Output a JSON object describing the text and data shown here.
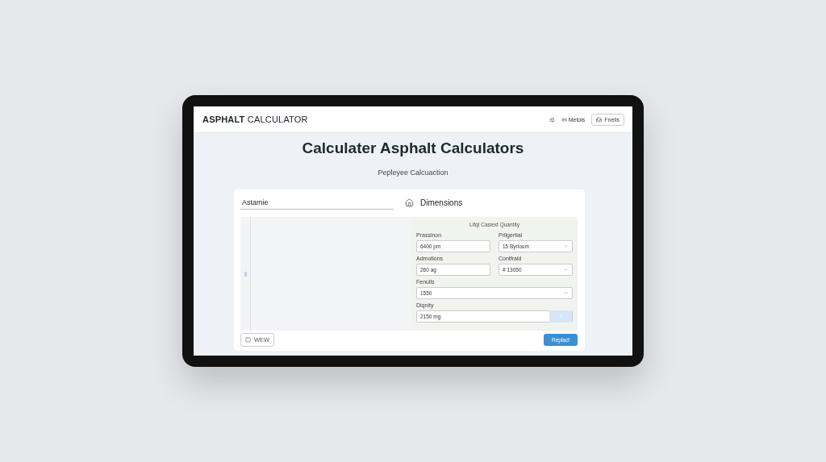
{
  "header": {
    "brand_bold": "ASPHALT",
    "brand_rest": "CALCULATOR",
    "link": "Metols",
    "button": "Fnells"
  },
  "hero": {
    "title": "Calculater Asphalt Calculators",
    "subtitle": "Pepleyee Calcuaction"
  },
  "card": {
    "name_field": {
      "value": "Astamie"
    },
    "section_title": "Dimensions",
    "form_title": "Lifqt Casiext Quantity",
    "fields": [
      {
        "label": "Prassinon",
        "value": "6400 pm",
        "kind": "text",
        "wide": false
      },
      {
        "label": "Prllgertial",
        "value": "15 Byrioum",
        "kind": "select",
        "wide": false
      },
      {
        "label": "Admotions",
        "value": "260 ag",
        "kind": "text",
        "wide": false
      },
      {
        "label": "Contfrald",
        "value": "# 13050",
        "kind": "select",
        "wide": false
      },
      {
        "label": "Fenulls",
        "value": "1550",
        "kind": "select",
        "wide": true
      },
      {
        "label": "Diqnity",
        "value": "2150 mg",
        "kind": "stepper",
        "wide": true
      }
    ],
    "view_button": "WEW",
    "submit_button": "Replact"
  }
}
